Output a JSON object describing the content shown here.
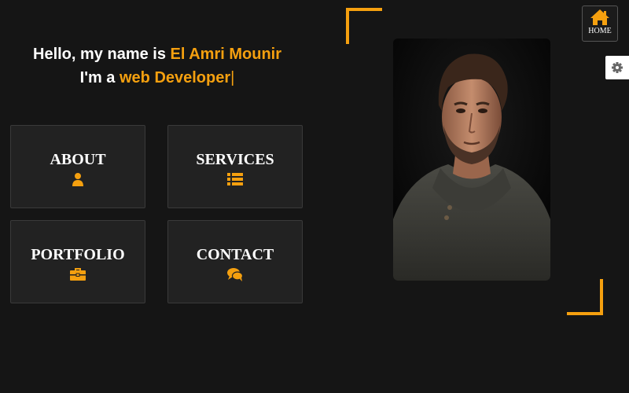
{
  "hero": {
    "line1_prefix": "Hello, my name is ",
    "name": "El Amri Mounir",
    "line2_prefix": "I'm a ",
    "role": "web Developer",
    "cursor": "|"
  },
  "cards": {
    "about": "ABOUT",
    "services": "SERVICES",
    "portfolio": "PORTFOLIO",
    "contact": "CONTACT"
  },
  "icons": {
    "about": "user-icon",
    "services": "list-icon",
    "portfolio": "briefcase-icon",
    "contact": "comments-icon",
    "home": "home-icon",
    "settings": "gear-icon"
  },
  "nav": {
    "home_label": "HOME"
  },
  "colors": {
    "accent": "#f5a00f",
    "background": "#151515",
    "card": "#222222"
  }
}
